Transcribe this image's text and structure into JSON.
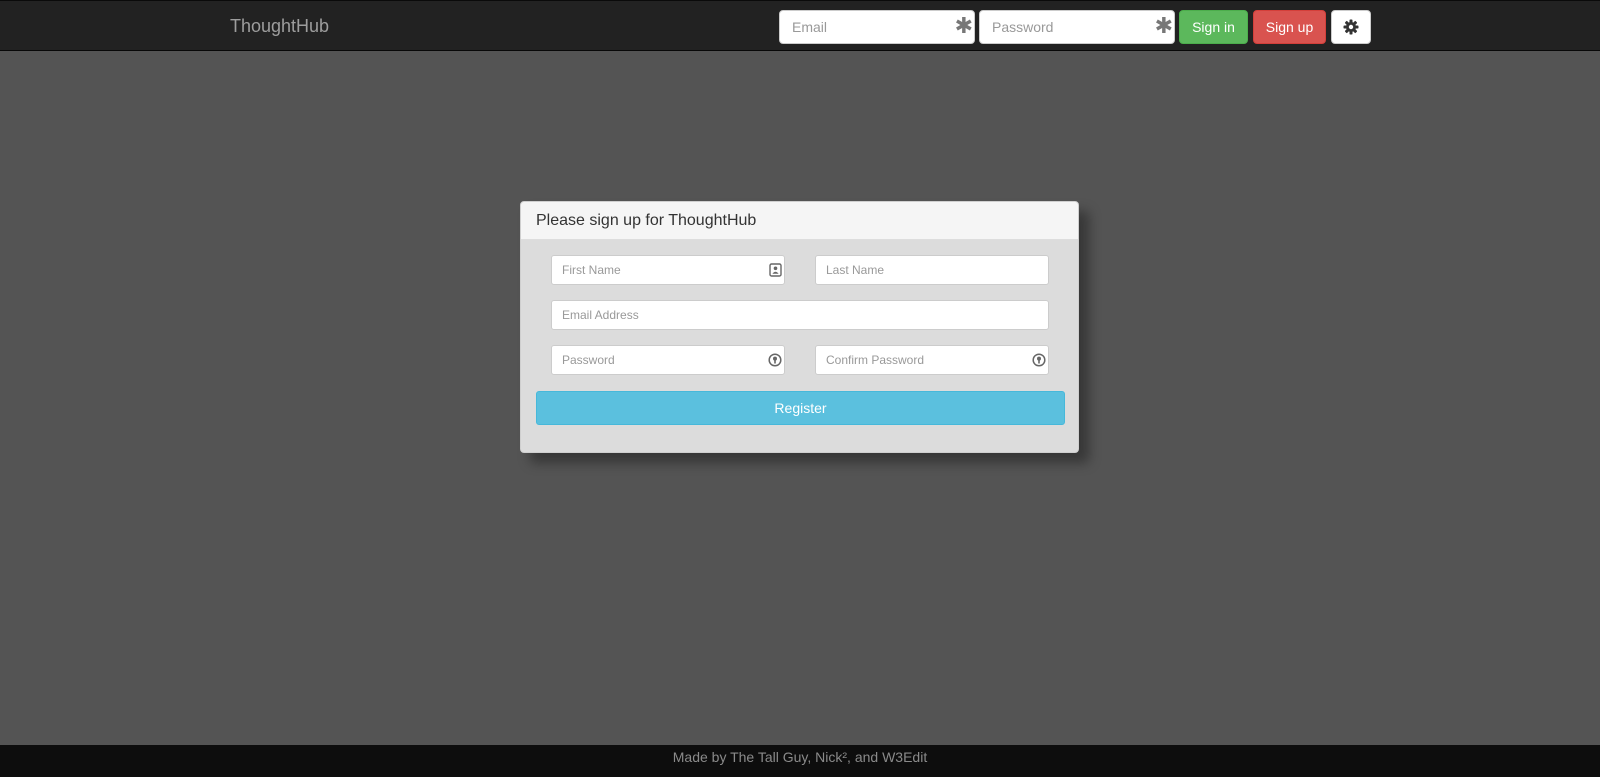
{
  "navbar": {
    "brand": "ThoughtHub",
    "email_placeholder": "Email",
    "password_placeholder": "Password",
    "signin_label": "Sign in",
    "signup_label": "Sign up",
    "required_icon": "asterisk-icon",
    "settings_icon": "gear-icon"
  },
  "signup": {
    "heading": "Please sign up for ThoughtHub",
    "first_name_placeholder": "First Name",
    "last_name_placeholder": "Last Name",
    "email_placeholder": "Email Address",
    "password_placeholder": "Password",
    "confirm_password_placeholder": "Confirm Password",
    "register_label": "Register"
  },
  "footer": {
    "text": "Made by The Tall Guy, Nick², and W3Edit"
  },
  "colors": {
    "navbar_bg": "#222222",
    "page_bg": "#545454",
    "signin": "#5cb85c",
    "signup": "#d9534f",
    "register": "#5bc0de",
    "footer_bg": "#0d0d0d"
  }
}
